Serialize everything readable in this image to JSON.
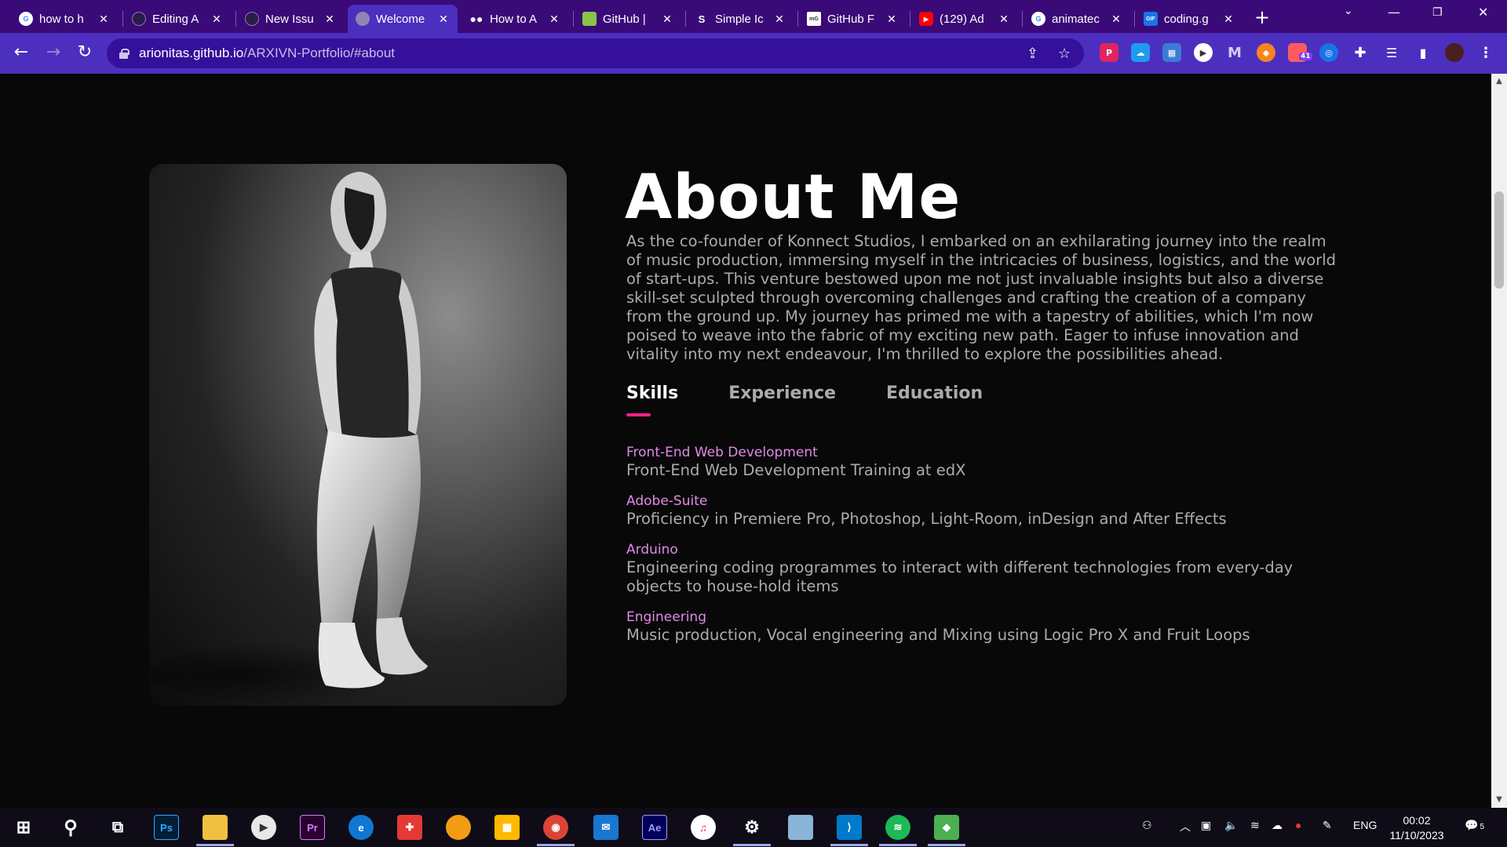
{
  "browser": {
    "tabs": [
      {
        "title": "how to h",
        "favicon": "google-icon",
        "active": false
      },
      {
        "title": "Editing A",
        "favicon": "github-icon",
        "active": false
      },
      {
        "title": "New Issu",
        "favicon": "github-icon",
        "active": false
      },
      {
        "title": "Welcome",
        "favicon": "globe-icon",
        "active": true
      },
      {
        "title": "How to A",
        "favicon": "medium-icon",
        "active": false
      },
      {
        "title": "GitHub |",
        "favicon": "github-pages-icon",
        "active": false
      },
      {
        "title": "Simple Ic",
        "favicon": "simple-icons-icon",
        "active": false
      },
      {
        "title": "GitHub F",
        "favicon": "mg-icon",
        "active": false
      },
      {
        "title": "(129) Ad",
        "favicon": "youtube-icon",
        "active": false
      },
      {
        "title": "animatec",
        "favicon": "google-icon",
        "active": false
      },
      {
        "title": "coding.g",
        "favicon": "gif-icon",
        "active": false
      }
    ],
    "url_host": "arionitas.github.io",
    "url_path": "/ARXIVN-Portfolio/#about",
    "extension_badge": "41"
  },
  "page": {
    "title": "About Me",
    "intro": "As the co-founder of Konnect Studios, I embarked on an exhilarating journey into the realm of music production, immersing myself in the intricacies of business, logistics, and the world of start-ups. This venture bestowed upon me not just invaluable insights but also a diverse skill-set sculpted through overcoming challenges and crafting the creation of a company from the ground up. My journey has primed me with a tapestry of abilities, which I'm now poised to weave into the fabric of my exciting new path. Eager to infuse innovation and vitality into my next endeavour, I'm thrilled to explore the possibilities ahead.",
    "tabs": [
      {
        "label": "Skills",
        "active": true
      },
      {
        "label": "Experience",
        "active": false
      },
      {
        "label": "Education",
        "active": false
      }
    ],
    "skills": [
      {
        "name": "Front-End Web Development",
        "desc": "Front-End Web Development Training at edX"
      },
      {
        "name": "Adobe-Suite",
        "desc": "Proficiency in Premiere Pro, Photoshop, Light-Room, inDesign and After Effects"
      },
      {
        "name": "Arduino",
        "desc": "Engineering coding programmes to interact with different technologies from every-day objects to house-hold items"
      },
      {
        "name": "Engineering",
        "desc": "Music production, Vocal engineering and Mixing using Logic Pro X and Fruit Loops"
      }
    ],
    "accent_color": "#ff1e8c",
    "skill_color": "#e08ae8"
  },
  "taskbar": {
    "apps": [
      "windows-start-icon",
      "search-icon",
      "task-view-icon",
      "photoshop-icon",
      "file-explorer-icon",
      "media-player-icon",
      "premiere-pro-icon",
      "edge-icon",
      "gift-icon",
      "fl-studio-icon",
      "store-icon",
      "chrome-icon",
      "mail-icon",
      "after-effects-icon",
      "itunes-icon",
      "settings-icon",
      "app-icon",
      "vscode-icon",
      "spotify-icon",
      "git-icon"
    ],
    "photoshop_label": "Ps",
    "premiere_label": "Pr",
    "after_effects_label": "Ae",
    "language": "ENG",
    "time": "00:02",
    "date": "11/10/2023",
    "notification_count": "5"
  }
}
